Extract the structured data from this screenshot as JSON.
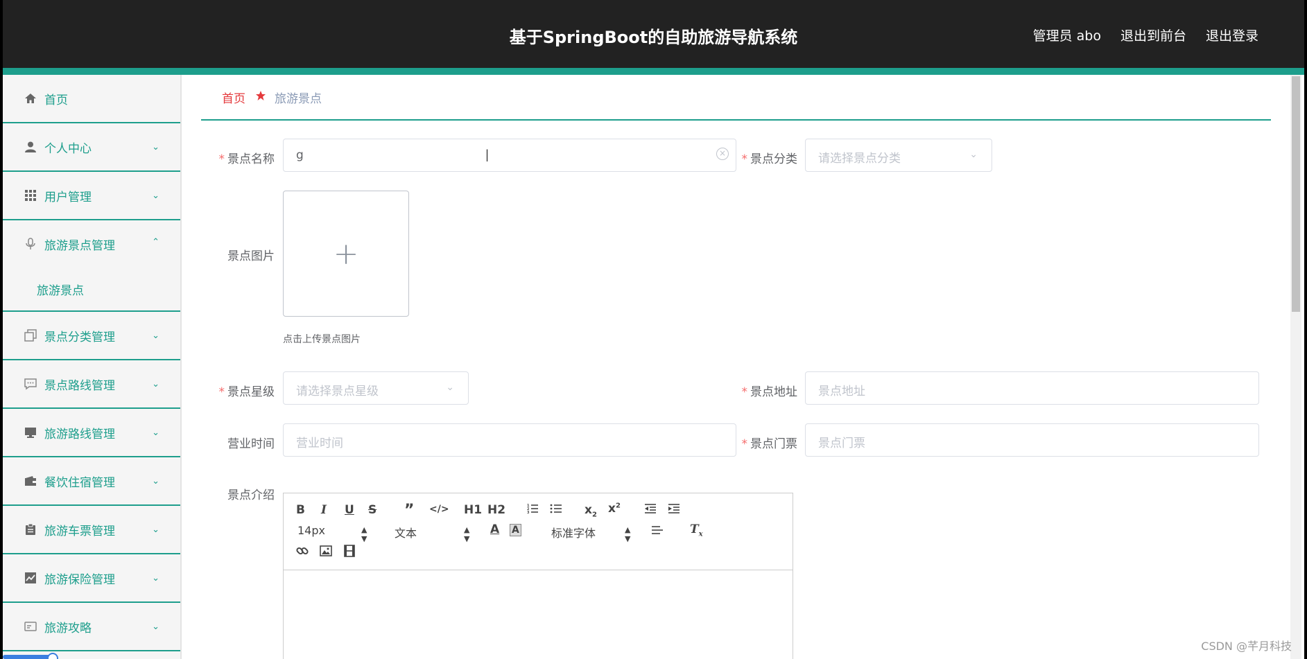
{
  "header": {
    "title": "基于SpringBoot的自助旅游导航系统",
    "user": "管理员 abo",
    "back_front": "退出到前台",
    "logout": "退出登录"
  },
  "sidebar": {
    "items": [
      {
        "label": "首页",
        "icon": "home-icon"
      },
      {
        "label": "个人中心",
        "icon": "user-icon"
      },
      {
        "label": "用户管理",
        "icon": "grid-icon"
      },
      {
        "label": "旅游景点管理",
        "icon": "microphone-icon"
      },
      {
        "label": "旅游景点",
        "icon": ""
      },
      {
        "label": "景点分类管理",
        "icon": "copy-icon"
      },
      {
        "label": "景点路线管理",
        "icon": "chat-icon"
      },
      {
        "label": "旅游路线管理",
        "icon": "monitor-icon"
      },
      {
        "label": "餐饮住宿管理",
        "icon": "wallet-icon"
      },
      {
        "label": "旅游车票管理",
        "icon": "clipboard-icon"
      },
      {
        "label": "旅游保险管理",
        "icon": "chart-icon"
      },
      {
        "label": "旅游攻略",
        "icon": "card-icon"
      }
    ]
  },
  "breadcrumb": {
    "home": "首页",
    "current": "旅游景点"
  },
  "form": {
    "name": {
      "label": "景点名称",
      "value": "g"
    },
    "category": {
      "label": "景点分类",
      "placeholder": "请选择景点分类"
    },
    "image": {
      "label": "景点图片",
      "tip": "点击上传景点图片"
    },
    "level": {
      "label": "景点星级",
      "placeholder": "请选择景点星级"
    },
    "address": {
      "label": "景点地址",
      "placeholder": "景点地址"
    },
    "hours": {
      "label": "营业时间",
      "placeholder": "营业时间"
    },
    "ticket": {
      "label": "景点门票",
      "placeholder": "景点门票"
    },
    "intro": {
      "label": "景点介绍"
    }
  },
  "editor": {
    "font_size": "14px",
    "paragraph": "文本",
    "font_family": "标准字体",
    "h1": "H1",
    "h2": "H2"
  },
  "watermark": "CSDN @芊月科技",
  "colors": {
    "accent": "#1d9e8c",
    "topbar": "#222222",
    "required": "#f56c6c",
    "breadcrumb_home": "#e4393c"
  }
}
